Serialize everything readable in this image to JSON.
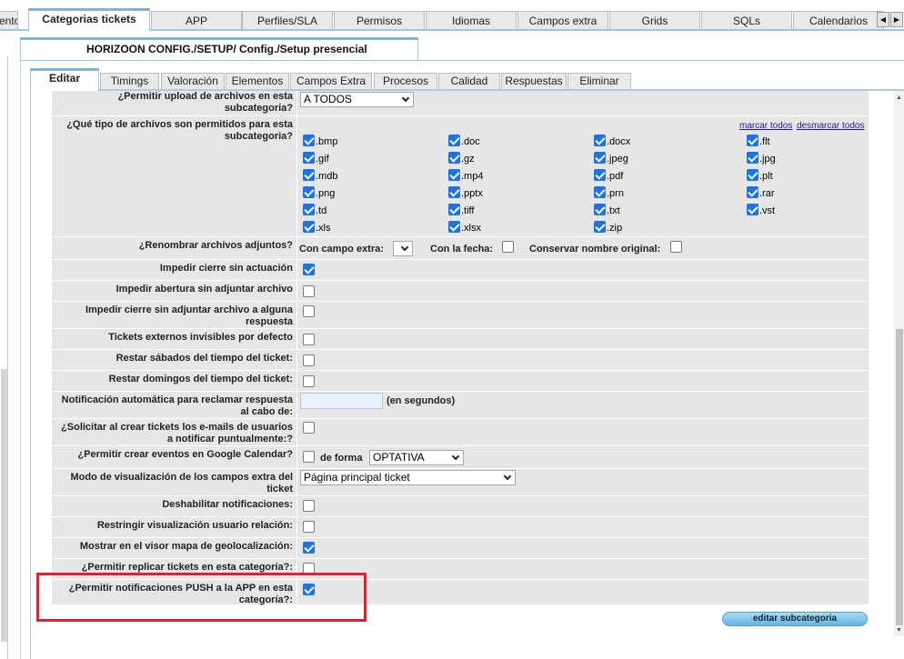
{
  "top_tabs": {
    "partial_left": "ento",
    "items": [
      {
        "label": "Categorias tickets",
        "active": true
      },
      {
        "label": "APP"
      },
      {
        "label": "Perfiles/SLA"
      },
      {
        "label": "Permisos"
      },
      {
        "label": "Idiomas"
      },
      {
        "label": "Campos extra"
      },
      {
        "label": "Grids"
      },
      {
        "label": "SQLs"
      },
      {
        "label": "Calendarios"
      }
    ],
    "scroll_left": "◀",
    "scroll_right": "▶"
  },
  "breadcrumb": "HORIZOON CONFIG./SETUP/ Config./Setup presencial",
  "inner_tabs": [
    "Editar",
    "Timings",
    "Valoración",
    "Elementos",
    "Campos Extra",
    "Procesos",
    "Calidad",
    "Respuestas",
    "Eliminar"
  ],
  "form": {
    "upload": {
      "label": "¿Permitir upload de archivos en esta subcategoria?",
      "value": "A TODOS"
    },
    "file_types": {
      "label": "¿Qué tipo de archivos son permitidos para esta subcategoria?",
      "mark_all": "marcar todos",
      "unmark_all": "desmarcar todos",
      "items": [
        {
          "ext": ".bmp",
          "checked": true
        },
        {
          "ext": ".doc",
          "checked": true
        },
        {
          "ext": ".docx",
          "checked": true
        },
        {
          "ext": ".flt",
          "checked": true
        },
        {
          "ext": ".gif",
          "checked": true
        },
        {
          "ext": ".gz",
          "checked": true
        },
        {
          "ext": ".jpeg",
          "checked": true
        },
        {
          "ext": ".jpg",
          "checked": true
        },
        {
          "ext": ".mdb",
          "checked": true
        },
        {
          "ext": ".mp4",
          "checked": true
        },
        {
          "ext": ".pdf",
          "checked": true
        },
        {
          "ext": ".plt",
          "checked": true
        },
        {
          "ext": ".png",
          "checked": true
        },
        {
          "ext": ".pptx",
          "checked": true
        },
        {
          "ext": ".prn",
          "checked": true
        },
        {
          "ext": ".rar",
          "checked": true
        },
        {
          "ext": ".td",
          "checked": true
        },
        {
          "ext": ".tiff",
          "checked": true
        },
        {
          "ext": ".txt",
          "checked": true
        },
        {
          "ext": ".vst",
          "checked": true
        },
        {
          "ext": ".xls",
          "checked": true
        },
        {
          "ext": ".xlsx",
          "checked": true
        },
        {
          "ext": ".zip",
          "checked": true
        }
      ]
    },
    "rename": {
      "label": "¿Renombrar archivos adjuntos?",
      "extra_field_label": "Con campo extra:",
      "extra_field_value": "",
      "date_label": "Con la fecha:",
      "date_checked": false,
      "keep_name_label": "Conservar nombre original:",
      "keep_name_checked": false
    },
    "rows": [
      {
        "label": "Impedir cierre sin actuación",
        "checked": true
      },
      {
        "label": "Impedir abertura sin adjuntar archivo",
        "checked": false
      },
      {
        "label": "Impedir cierre sin adjuntar archivo a alguna respuesta",
        "checked": false
      },
      {
        "label": "Tickets externos invisibles por defecto",
        "checked": false
      },
      {
        "label": "Restar sábados del tiempo del ticket:",
        "checked": false
      },
      {
        "label": "Restar domingos del tiempo del ticket:",
        "checked": false
      }
    ],
    "auto_notif": {
      "label": "Notificación automática para reclamar respuesta al cabo de:",
      "value": "",
      "unit": "(en segundos)"
    },
    "request_emails": {
      "label": "¿Solicitar al crear tickets los e-mails de usuarios a notificar puntualmente:?",
      "checked": false
    },
    "google_calendar": {
      "label": "¿Permitir crear eventos en Google Calendar?",
      "checked": false,
      "mode_label": "de forma",
      "mode_value": "OPTATIVA"
    },
    "view_mode": {
      "label": "Modo de visualización de los campos extra del ticket",
      "value": "Página principal ticket"
    },
    "rows2": [
      {
        "label": "Deshabilitar notificaciones:",
        "checked": false
      },
      {
        "label": "Restringir visualización usuario relación:",
        "checked": false
      },
      {
        "label": "Mostrar en el visor mapa de geolocalización:",
        "checked": true
      },
      {
        "label": "¿Permitir replicar tickets en esta categoría?:",
        "checked": false
      },
      {
        "label": "¿Permitir notificaciones PUSH a la APP en esta categoría?:",
        "checked": true
      }
    ]
  },
  "edit_button": "editar subcategoria",
  "colors": {
    "accent_blue": "#1a73e8",
    "highlight_red": "#e0232a",
    "tab_border": "#9fc6e8",
    "row_bg": "#e6e6e6"
  }
}
